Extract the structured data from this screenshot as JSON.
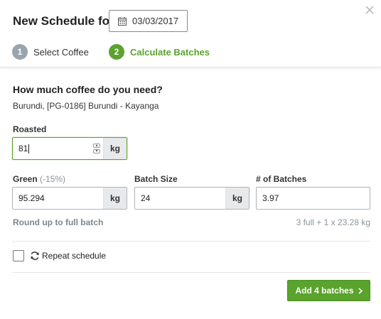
{
  "header": {
    "title": "New Schedule for",
    "date": "03/03/2017",
    "close_icon": "close-icon"
  },
  "steps": [
    {
      "number": "1",
      "label": "Select Coffee",
      "active": false
    },
    {
      "number": "2",
      "label": "Calculate Batches",
      "active": true
    }
  ],
  "main": {
    "question": "How much coffee do you need?",
    "coffee_name": "Burundi, [PG-0186] Burundi - Kayanga"
  },
  "roasted": {
    "label": "Roasted",
    "value": "81",
    "unit": "kg"
  },
  "green": {
    "label": "Green",
    "note": "(-15%)",
    "value": "95.294",
    "unit": "kg"
  },
  "batch_size": {
    "label": "Batch Size",
    "value": "24",
    "unit": "kg"
  },
  "num_batches": {
    "label": "# of Batches",
    "value": "3.97"
  },
  "round_up_label": "Round up to full batch",
  "batches_info": "3 full + 1 x 23.28 kg",
  "repeat": {
    "label": "Repeat schedule",
    "checked": false
  },
  "add_button": {
    "label": "Add 4 batches"
  },
  "colors": {
    "accent": "#5aa32c",
    "inactive_step": "#9aa4ae",
    "muted_text": "#8a949c"
  }
}
